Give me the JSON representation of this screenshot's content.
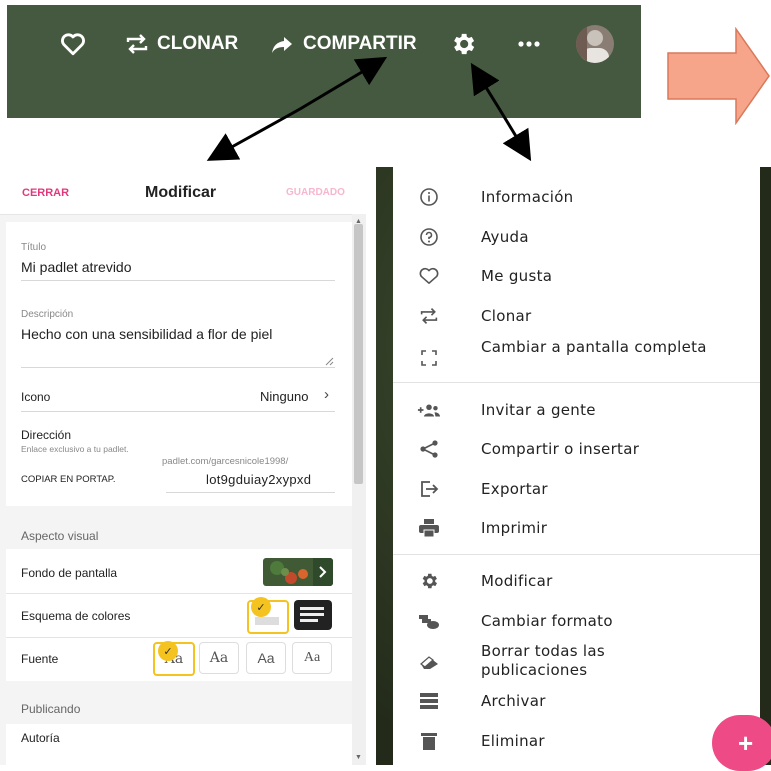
{
  "topbar": {
    "clone_label": "CLONAR",
    "share_label": "COMPARTIR",
    "icons": [
      "heart-icon",
      "repeat-icon",
      "share-arrow-icon",
      "gear-icon",
      "more-icon",
      "avatar"
    ]
  },
  "edit_panel": {
    "close_label": "CERRAR",
    "title": "Modificar",
    "saved_label": "GUARDADO",
    "title_field": {
      "label": "Título",
      "value": "Mi padlet atrevido"
    },
    "description_field": {
      "label": "Descripción",
      "value": "Hecho con una sensibilidad a flor de piel"
    },
    "icon_row": {
      "label": "Icono",
      "value": "Ninguno"
    },
    "address": {
      "label": "Dirección",
      "hint": "Enlace exclusivo a tu padlet.",
      "copy_label": "COPIAR EN PORTAP.",
      "url_prefix": "padlet.com/garcesnicole1998/",
      "url_slug": "lot9gduiay2xypxd"
    },
    "visual_section": "Aspecto visual",
    "wallpaper_label": "Fondo de pantalla",
    "color_scheme_label": "Esquema de colores",
    "font_label": "Fuente",
    "font_options": [
      "Aa",
      "Aa",
      "Aa",
      "Aa"
    ],
    "publishing_section": "Publicando",
    "authorship_label": "Autoría"
  },
  "menu": {
    "items": [
      {
        "label": "Información",
        "icon": "info-icon"
      },
      {
        "label": "Ayuda",
        "icon": "help-icon"
      },
      {
        "label": "Me gusta",
        "icon": "heart-outline-icon"
      },
      {
        "label": "Clonar",
        "icon": "repeat-icon"
      },
      {
        "label": "Cambiar a pantalla completa",
        "icon": "fullscreen-icon"
      },
      {
        "label": "Invitar a gente",
        "icon": "invite-people-icon"
      },
      {
        "label": "Compartir o insertar",
        "icon": "share-icon"
      },
      {
        "label": "Exportar",
        "icon": "export-icon"
      },
      {
        "label": "Imprimir",
        "icon": "print-icon"
      },
      {
        "label": "Modificar",
        "icon": "gear-icon"
      },
      {
        "label": "Cambiar formato",
        "icon": "format-icon"
      },
      {
        "label": "Borrar todas las publicaciones",
        "icon": "eraser-icon"
      },
      {
        "label": "Archivar",
        "icon": "archive-icon"
      },
      {
        "label": "Eliminar",
        "icon": "trash-icon"
      }
    ]
  },
  "fab_label": "+",
  "colors": {
    "topbar": "#44593f",
    "accent_pink": "#e03a7c",
    "fab": "#ee4a86",
    "callout_arrow": "#f6a58a",
    "check": "#f4c31f"
  }
}
